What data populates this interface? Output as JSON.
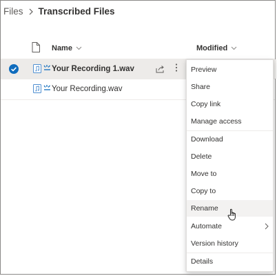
{
  "breadcrumb": {
    "root": "Files",
    "current": "Transcribed Files"
  },
  "columns": {
    "name": "Name",
    "modified": "Modified"
  },
  "files": [
    {
      "name": "Your Recording 1.wav",
      "selected": true
    },
    {
      "name": "Your Recording.wav",
      "selected": false
    }
  ],
  "menu": {
    "items": [
      "Preview",
      "Share",
      "Copy link",
      "Manage access",
      "Download",
      "Delete",
      "Move to",
      "Copy to",
      "Rename",
      "Automate",
      "Version history",
      "Details"
    ],
    "highlighted": "Rename",
    "submenu_item": "Automate"
  },
  "colors": {
    "accent": "#0f6cbd",
    "spark": "#0f6cbd",
    "selection": "#edebe9",
    "hover": "#f3f2f1"
  },
  "icons": [
    "chevron-right-icon",
    "file-icon",
    "chevron-down-icon",
    "check-circle-icon",
    "audio-file-icon",
    "sparkle-icon",
    "share-icon",
    "more-icon",
    "hand-cursor-icon"
  ]
}
